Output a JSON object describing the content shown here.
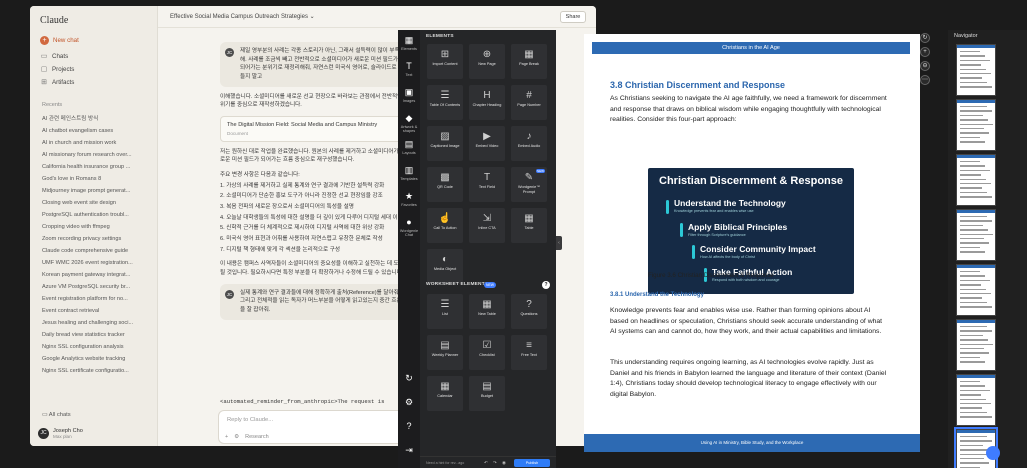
{
  "claude": {
    "brand": "Claude",
    "nav": [
      {
        "icon": "plus-icon",
        "label": "New chat"
      },
      {
        "icon": "chat-icon",
        "label": "Chats"
      },
      {
        "icon": "folder-icon",
        "label": "Projects"
      },
      {
        "icon": "artifacts-icon",
        "label": "Artifacts"
      }
    ],
    "recents_header": "Recents",
    "recents": [
      "AI 관련 메인스트림 방식",
      "AI chatbot evangelism cases",
      "AI in church and mission work",
      "AI missionary forum research over...",
      "California health insurance group ...",
      "God's love in Romans 8",
      "Midjourney image prompt generat...",
      "Closing web event site design",
      "PostgreSQL authentication troubl...",
      "Cropping video with ffmpeg",
      "Zoom recording privacy settings",
      "Claude code comprehensive guide",
      "UMF WMC 2026 event registration...",
      "Korean payment gateway integrat...",
      "Azure VM PostgreSQL security br...",
      "Event registration platform for no...",
      "Event contract retrieval",
      "Jesus healing and challenging soci...",
      "Daily bread view statistics tracker",
      "Nginx SSL configuration analysis",
      "Google Analytics website tracking",
      "Nginx SSL certificate configuratio..."
    ],
    "all_chats": "All chats",
    "user_initials": "JC",
    "user_name": "Joseph Cho",
    "user_plan": "Max plan",
    "conversation_title": "Effective Social Media Campus Outreach Strategies",
    "share_label": "Share",
    "chat": {
      "user_avatar": "JC",
      "user_msg": "제일 영부분의 사례는 각종 스토리가 아닌, 그래서 설득력이 많이 부족해. 사례를 조금씩 빼고 전반적으로 소셜미디어가 새로운 미션 필드가 되어가는 분위기로 재정리해줘, 자연스런 미국식 영어로, 슬라이드로 만들지 말고",
      "reply_intro": "이해했습니다. 소셜미디어를 새로운 선교 현장으로 바라보는 관점에서 전반적인 분위기를 중심으로 재작성하겠습니다.",
      "doc_title": "The Digital Mission Field: Social Media and Campus Ministry",
      "doc_type": "Document",
      "reply_body": "저는 원하신 대로 작업을 완료했습니다. 원본의 사례를 제거하고 소셜미디어가 새로운 미션 필드가 되어가는 흐름 중심으로 재구성했습니다.",
      "changes_header": "주요 변경 사항은 다음과 같습니다:",
      "changes": [
        "1. 가상의 사례를 제거하고 실제 통계와 연구 결과에 기반한 설득력 강화",
        "2. 소셜미디어가 단순한 홍보 도구가 아니라 진정한 선교 현장임을 강조",
        "3. 복음 전파의 새로운 장으로서 소셜미디어의 특성을 설명",
        "4. 오늘날 대학생들의 특성에 대한 설명을 더 깊이 있게 다루어 디지털 세대 이해",
        "5. 신학적 근거를 더 체계적으로 제시하여 디지털 사역에 대한 위상 강화",
        "6. 미국식 영어 표현과 어휘를 사용하여 자연스럽고 유창한 문체로 작성",
        "7. 디지털 책 형태에 맞게 각 섹션을 논리적으로 구성"
      ],
      "reply_close": "이 내용은 캠퍼스 사역자들이 소셜미디어의 중요성을 이해하고 실천하는 데 도움이 될 것입니다. 필요하시다면 특정 부분을 더 확장하거나 수정해 드릴 수 있습니다.",
      "user_msg2": "실제 통계와 연구 결과들에 대해 정확하게 출처(Reference)를 달아줘. 그리고 전체적을 읽는 독자가 머느부분을 어떻게 읽고있는지 중간 흐름을 잘 잡아줘.",
      "reminder": "<automated_reminder_from_anthropic>The request is",
      "input_placeholder": "Reply to Claude...",
      "input_tools": [
        "+",
        "⚙",
        "Research"
      ]
    }
  },
  "rail": [
    {
      "icon": "elements-icon",
      "glyph": "▦",
      "label": "Elements"
    },
    {
      "icon": "text-icon",
      "glyph": "T",
      "label": "Text"
    },
    {
      "icon": "images-icon",
      "glyph": "▣",
      "label": "Images"
    },
    {
      "icon": "shapes-icon",
      "glyph": "◆",
      "label": "Artwork & shapes"
    },
    {
      "icon": "layouts-icon",
      "glyph": "▤",
      "label": "Layouts"
    },
    {
      "icon": "templates-icon",
      "glyph": "▥",
      "label": "Templates"
    },
    {
      "icon": "favorites-icon",
      "glyph": "★",
      "label": "Favorites"
    },
    {
      "icon": "wordgenie-icon",
      "glyph": "●",
      "label": "Wordgenie Chat"
    }
  ],
  "rail_bottom": [
    {
      "icon": "history-icon",
      "glyph": "↻"
    },
    {
      "icon": "settings-icon",
      "glyph": "⚙"
    },
    {
      "icon": "help-icon",
      "glyph": "?"
    },
    {
      "icon": "exit-icon",
      "glyph": "⇥"
    }
  ],
  "panel": {
    "elements_header": "ELEMENTS",
    "elements": [
      {
        "icon": "import-content-icon",
        "glyph": "⊞",
        "label": "Import Content"
      },
      {
        "icon": "new-page-icon",
        "glyph": "⊕",
        "label": "New Page"
      },
      {
        "icon": "page-break-icon",
        "glyph": "▦",
        "label": "Page Break"
      },
      {
        "icon": "table-of-contents-icon",
        "glyph": "☰",
        "label": "Table Of Contents"
      },
      {
        "icon": "chapter-heading-icon",
        "glyph": "H",
        "label": "Chapter Heading"
      },
      {
        "icon": "page-number-icon",
        "glyph": "#",
        "label": "Page Number"
      },
      {
        "icon": "captioned-image-icon",
        "glyph": "▨",
        "label": "Captioned Image"
      },
      {
        "icon": "embed-video-icon",
        "glyph": "▶",
        "label": "Embed Video"
      },
      {
        "icon": "embed-audio-icon",
        "glyph": "♪",
        "label": "Embed Audio"
      },
      {
        "icon": "qr-code-icon",
        "glyph": "▩",
        "label": "QR Code"
      },
      {
        "icon": "text-field-icon",
        "glyph": "T",
        "label": "Text Field"
      },
      {
        "icon": "wordgenie-prompt-icon",
        "glyph": "✎",
        "label": "Wordgenie™ Prompt",
        "badge": "NEW"
      },
      {
        "icon": "call-to-action-icon",
        "glyph": "☝",
        "label": "Call To Action"
      },
      {
        "icon": "inline-cta-icon",
        "glyph": "⇲",
        "label": "Inline CTA"
      },
      {
        "icon": "table-icon",
        "glyph": "▦",
        "label": "Table"
      },
      {
        "icon": "media-object-icon",
        "glyph": "◐",
        "label": "Media Object"
      }
    ],
    "worksheet_header": "WORKSHEET ELEMENTS",
    "worksheet_badge": "NEW",
    "worksheet": [
      {
        "icon": "list-icon",
        "glyph": "☰",
        "label": "List"
      },
      {
        "icon": "new-table-icon",
        "glyph": "▦",
        "label": "New Table"
      },
      {
        "icon": "questions-icon",
        "glyph": "?",
        "label": "Questions"
      },
      {
        "icon": "weekly-planner-icon",
        "glyph": "▤",
        "label": "Weekly Planner"
      },
      {
        "icon": "checklist-icon",
        "glyph": "☑",
        "label": "Checklist"
      },
      {
        "icon": "free-text-icon",
        "glyph": "≡",
        "label": "Free Text"
      },
      {
        "icon": "calendar-icon",
        "glyph": "▦",
        "label": "Calendar"
      },
      {
        "icon": "budget-icon",
        "glyph": "▤",
        "label": "Budget"
      }
    ],
    "footer_text": "Need a hint for rev...ago",
    "footer_icons": "↶ ↷ ◉",
    "footer_button": "Publish"
  },
  "document": {
    "running_head": "Christians in the AI Age",
    "section_title": "3.8 Christian Discernment and Response",
    "intro": "As Christians seeking to navigate the AI age faithfully, we need a framework for discernment and response that draws on biblical wisdom while engaging thoughtfully with technological realities. Consider this four-part approach:",
    "figure": {
      "title": "Christian Discernment & Response",
      "steps": [
        {
          "title": "Understand the Technology",
          "sub": "Knowledge prevents fear and enables wise use"
        },
        {
          "title": "Apply Biblical Principles",
          "sub": "Filter through Scripture's guidance"
        },
        {
          "title": "Consider Community Impact",
          "sub": "How AI affects the body of Christ"
        },
        {
          "title": "Take Faithful Action",
          "sub": "Respond with both wisdom and courage"
        }
      ]
    },
    "caption": "Figure 3.6 Christian Discernment & Response",
    "subsection_title": "3.8.1 Understand the Technology",
    "para1": "Knowledge prevents fear and enables wise use. Rather than forming opinions about AI based on headlines or speculation, Christians should seek accurate understanding of what AI systems can and cannot do, how they work, and their actual capabilities and limitations.",
    "para2": "This understanding requires ongoing learning, as AI technologies evolve rapidly. Just as Daniel and his friends in Babylon learned the language and literature of their context (Daniel 1:4), Christians today should develop technological literacy to engage effectively with our digital Babylon.",
    "footer": "Using AI in Ministry, Bible Study, and the Workplace"
  },
  "navigator": {
    "title": "Navigator",
    "thumb_count": 8,
    "selected_index": 7
  },
  "colors": {
    "accent_blue": "#2d6ab3",
    "claude_orange": "#d1693f",
    "figure_bg": "#152a45",
    "figure_line": "#2cc8d6",
    "publish_blue": "#2f7cf6"
  }
}
